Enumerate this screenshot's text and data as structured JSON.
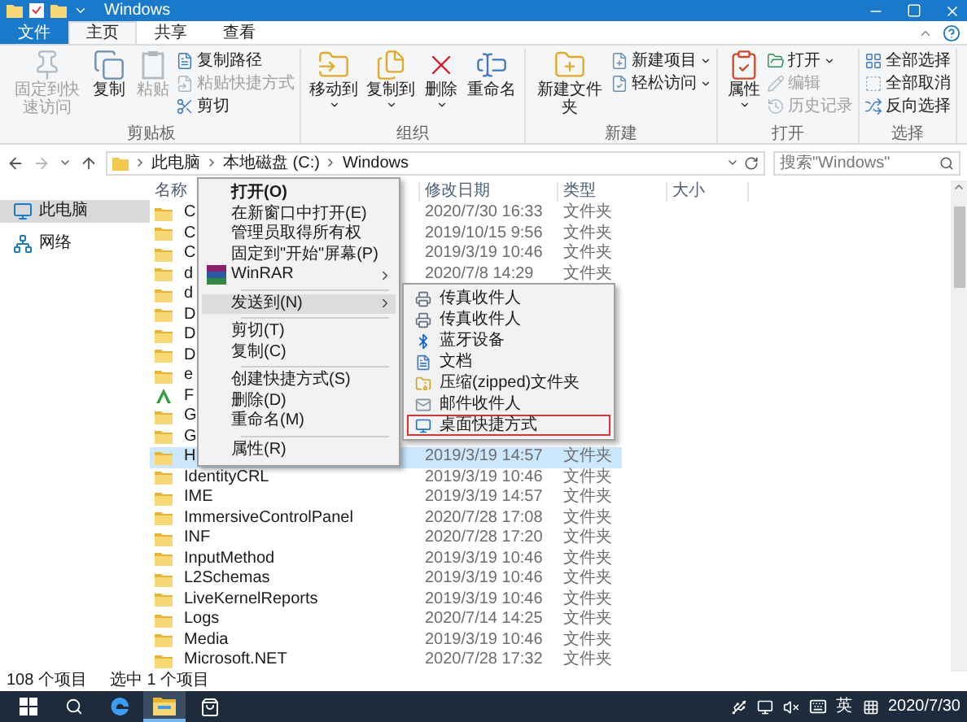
{
  "window": {
    "title": "Windows"
  },
  "ribbon_tabs": [
    {
      "label": "文件",
      "kind": "file",
      "selected": false
    },
    {
      "label": "主页",
      "kind": "tab",
      "selected": true
    },
    {
      "label": "共享",
      "kind": "tab",
      "selected": false
    },
    {
      "label": "查看",
      "kind": "tab",
      "selected": false
    }
  ],
  "ribbon_groups": [
    {
      "label": "剪贴板",
      "commands": [
        {
          "label": "固定到快速访问",
          "kind": "large",
          "disabled": true,
          "dropdown": false
        },
        {
          "label": "复制",
          "kind": "large",
          "disabled": false,
          "dropdown": false
        },
        {
          "label": "粘贴",
          "kind": "large",
          "disabled": true,
          "dropdown": false
        },
        {
          "label": "复制路径",
          "kind": "small",
          "disabled": false,
          "dropdown": false
        },
        {
          "label": "粘贴快捷方式",
          "kind": "small",
          "disabled": true,
          "dropdown": false
        },
        {
          "label": "剪切",
          "kind": "small",
          "disabled": false,
          "dropdown": false
        }
      ]
    },
    {
      "label": "组织",
      "commands": [
        {
          "label": "移动到",
          "kind": "large",
          "disabled": false,
          "dropdown": true
        },
        {
          "label": "复制到",
          "kind": "large",
          "disabled": false,
          "dropdown": true
        },
        {
          "label": "删除",
          "kind": "large",
          "disabled": false,
          "dropdown": true
        },
        {
          "label": "重命名",
          "kind": "large",
          "disabled": false,
          "dropdown": false
        }
      ]
    },
    {
      "label": "新建",
      "commands": [
        {
          "label": "新建文件夹",
          "kind": "large",
          "disabled": false,
          "dropdown": false
        },
        {
          "label": "新建项目",
          "kind": "small",
          "disabled": false,
          "dropdown": true
        },
        {
          "label": "轻松访问",
          "kind": "small",
          "disabled": false,
          "dropdown": true
        }
      ]
    },
    {
      "label": "打开",
      "commands": [
        {
          "label": "属性",
          "kind": "large",
          "disabled": false,
          "dropdown": true
        },
        {
          "label": "打开",
          "kind": "small",
          "disabled": false,
          "dropdown": true
        },
        {
          "label": "编辑",
          "kind": "small",
          "disabled": true,
          "dropdown": false
        },
        {
          "label": "历史记录",
          "kind": "small",
          "disabled": true,
          "dropdown": false
        }
      ]
    },
    {
      "label": "选择",
      "commands": [
        {
          "label": "全部选择",
          "kind": "small",
          "disabled": false,
          "dropdown": false
        },
        {
          "label": "全部取消",
          "kind": "small",
          "disabled": false,
          "dropdown": false
        },
        {
          "label": "反向选择",
          "kind": "small",
          "disabled": false,
          "dropdown": false
        }
      ]
    }
  ],
  "address": {
    "breadcrumbs": [
      "此电脑",
      "本地磁盘 (C:)",
      "Windows"
    ],
    "search_placeholder": "搜索\"Windows\""
  },
  "sidebar": {
    "items": [
      {
        "label": "此电脑",
        "selected": true
      },
      {
        "label": "网络",
        "selected": false
      }
    ]
  },
  "table": {
    "columns": [
      "名称",
      "修改日期",
      "类型",
      "大小"
    ],
    "rows": [
      {
        "name": "C",
        "date": "2020/7/30 16:33",
        "type": "文件夹",
        "kind": "folder",
        "selected": false
      },
      {
        "name": "C",
        "date": "2019/10/15 9:56",
        "type": "文件夹",
        "kind": "folder",
        "selected": false
      },
      {
        "name": "C",
        "date": "2019/3/19 10:46",
        "type": "文件夹",
        "kind": "folder",
        "selected": false
      },
      {
        "name": "d",
        "date": "2020/7/8 14:29",
        "type": "文件夹",
        "kind": "folder",
        "selected": false
      },
      {
        "name": "d",
        "kind": "folder",
        "selected": false
      },
      {
        "name": "D",
        "kind": "folder",
        "selected": false
      },
      {
        "name": "D",
        "kind": "folder",
        "selected": false
      },
      {
        "name": "D",
        "kind": "folder",
        "selected": false
      },
      {
        "name": "e",
        "kind": "folder",
        "selected": false
      },
      {
        "name": "F",
        "kind": "fonts",
        "selected": false
      },
      {
        "name": "G",
        "kind": "folder",
        "selected": false
      },
      {
        "name": "G",
        "kind": "folder",
        "selected": false
      },
      {
        "name": "H",
        "date": "2019/3/19 14:57",
        "type": "文件夹",
        "kind": "folder",
        "selected": true
      },
      {
        "name": "IdentityCRL",
        "date": "2019/3/19 10:46",
        "type": "文件夹",
        "kind": "folder",
        "selected": false
      },
      {
        "name": "IME",
        "date": "2019/3/19 14:57",
        "type": "文件夹",
        "kind": "folder",
        "selected": false
      },
      {
        "name": "ImmersiveControlPanel",
        "date": "2020/7/28 17:08",
        "type": "文件夹",
        "kind": "folder",
        "selected": false
      },
      {
        "name": "INF",
        "date": "2020/7/28 17:20",
        "type": "文件夹",
        "kind": "folder",
        "selected": false
      },
      {
        "name": "InputMethod",
        "date": "2019/3/19 10:46",
        "type": "文件夹",
        "kind": "folder",
        "selected": false
      },
      {
        "name": "L2Schemas",
        "date": "2019/3/19 10:46",
        "type": "文件夹",
        "kind": "folder",
        "selected": false
      },
      {
        "name": "LiveKernelReports",
        "date": "2019/3/19 10:46",
        "type": "文件夹",
        "kind": "folder",
        "selected": false
      },
      {
        "name": "Logs",
        "date": "2020/7/14 14:25",
        "type": "文件夹",
        "kind": "folder",
        "selected": false
      },
      {
        "name": "Media",
        "date": "2019/3/19 10:46",
        "type": "文件夹",
        "kind": "folder",
        "selected": false
      },
      {
        "name": "Microsoft.NET",
        "date": "2020/7/28 17:32",
        "type": "文件夹",
        "kind": "folder",
        "selected": false
      }
    ]
  },
  "context_menu": {
    "items": [
      {
        "kind": "command",
        "label": "打开(O)",
        "default": true,
        "highlighted": false,
        "submenu": false
      },
      {
        "kind": "command",
        "label": "在新窗口中打开(E)",
        "default": false,
        "highlighted": false,
        "submenu": false
      },
      {
        "kind": "command",
        "label": "管理员取得所有权",
        "default": false,
        "highlighted": false,
        "submenu": false
      },
      {
        "kind": "command",
        "label": "固定到\"开始\"屏幕(P)",
        "default": false,
        "highlighted": false,
        "submenu": false
      },
      {
        "kind": "app",
        "label": "WinRAR",
        "default": false,
        "highlighted": false,
        "submenu": true
      },
      {
        "kind": "separator"
      },
      {
        "kind": "command",
        "label": "发送到(N)",
        "default": false,
        "highlighted": true,
        "submenu": true
      },
      {
        "kind": "separator"
      },
      {
        "kind": "command",
        "label": "剪切(T)",
        "default": false,
        "highlighted": false,
        "submenu": false
      },
      {
        "kind": "command",
        "label": "复制(C)",
        "default": false,
        "highlighted": false,
        "submenu": false
      },
      {
        "kind": "separator"
      },
      {
        "kind": "command",
        "label": "创建快捷方式(S)",
        "default": false,
        "highlighted": false,
        "submenu": false
      },
      {
        "kind": "command",
        "label": "删除(D)",
        "default": false,
        "highlighted": false,
        "submenu": false
      },
      {
        "kind": "command",
        "label": "重命名(M)",
        "default": false,
        "highlighted": false,
        "submenu": false
      },
      {
        "kind": "separator"
      },
      {
        "kind": "command",
        "label": "属性(R)",
        "default": false,
        "highlighted": false,
        "submenu": false
      }
    ]
  },
  "send_to_menu": {
    "items": [
      {
        "label": "传真收件人",
        "highlighted": false
      },
      {
        "label": "传真收件人",
        "highlighted": false
      },
      {
        "label": "蓝牙设备",
        "highlighted": false
      },
      {
        "label": "文档",
        "highlighted": false
      },
      {
        "label": "压缩(zipped)文件夹",
        "highlighted": false
      },
      {
        "label": "邮件收件人",
        "highlighted": false
      },
      {
        "label": "桌面快捷方式",
        "highlighted": true
      }
    ]
  },
  "status_bar": {
    "item_count": "108 个项目",
    "selection": "选中 1 个项目"
  },
  "taskbar": {
    "input_language": "英",
    "date": "2020/7/30"
  }
}
